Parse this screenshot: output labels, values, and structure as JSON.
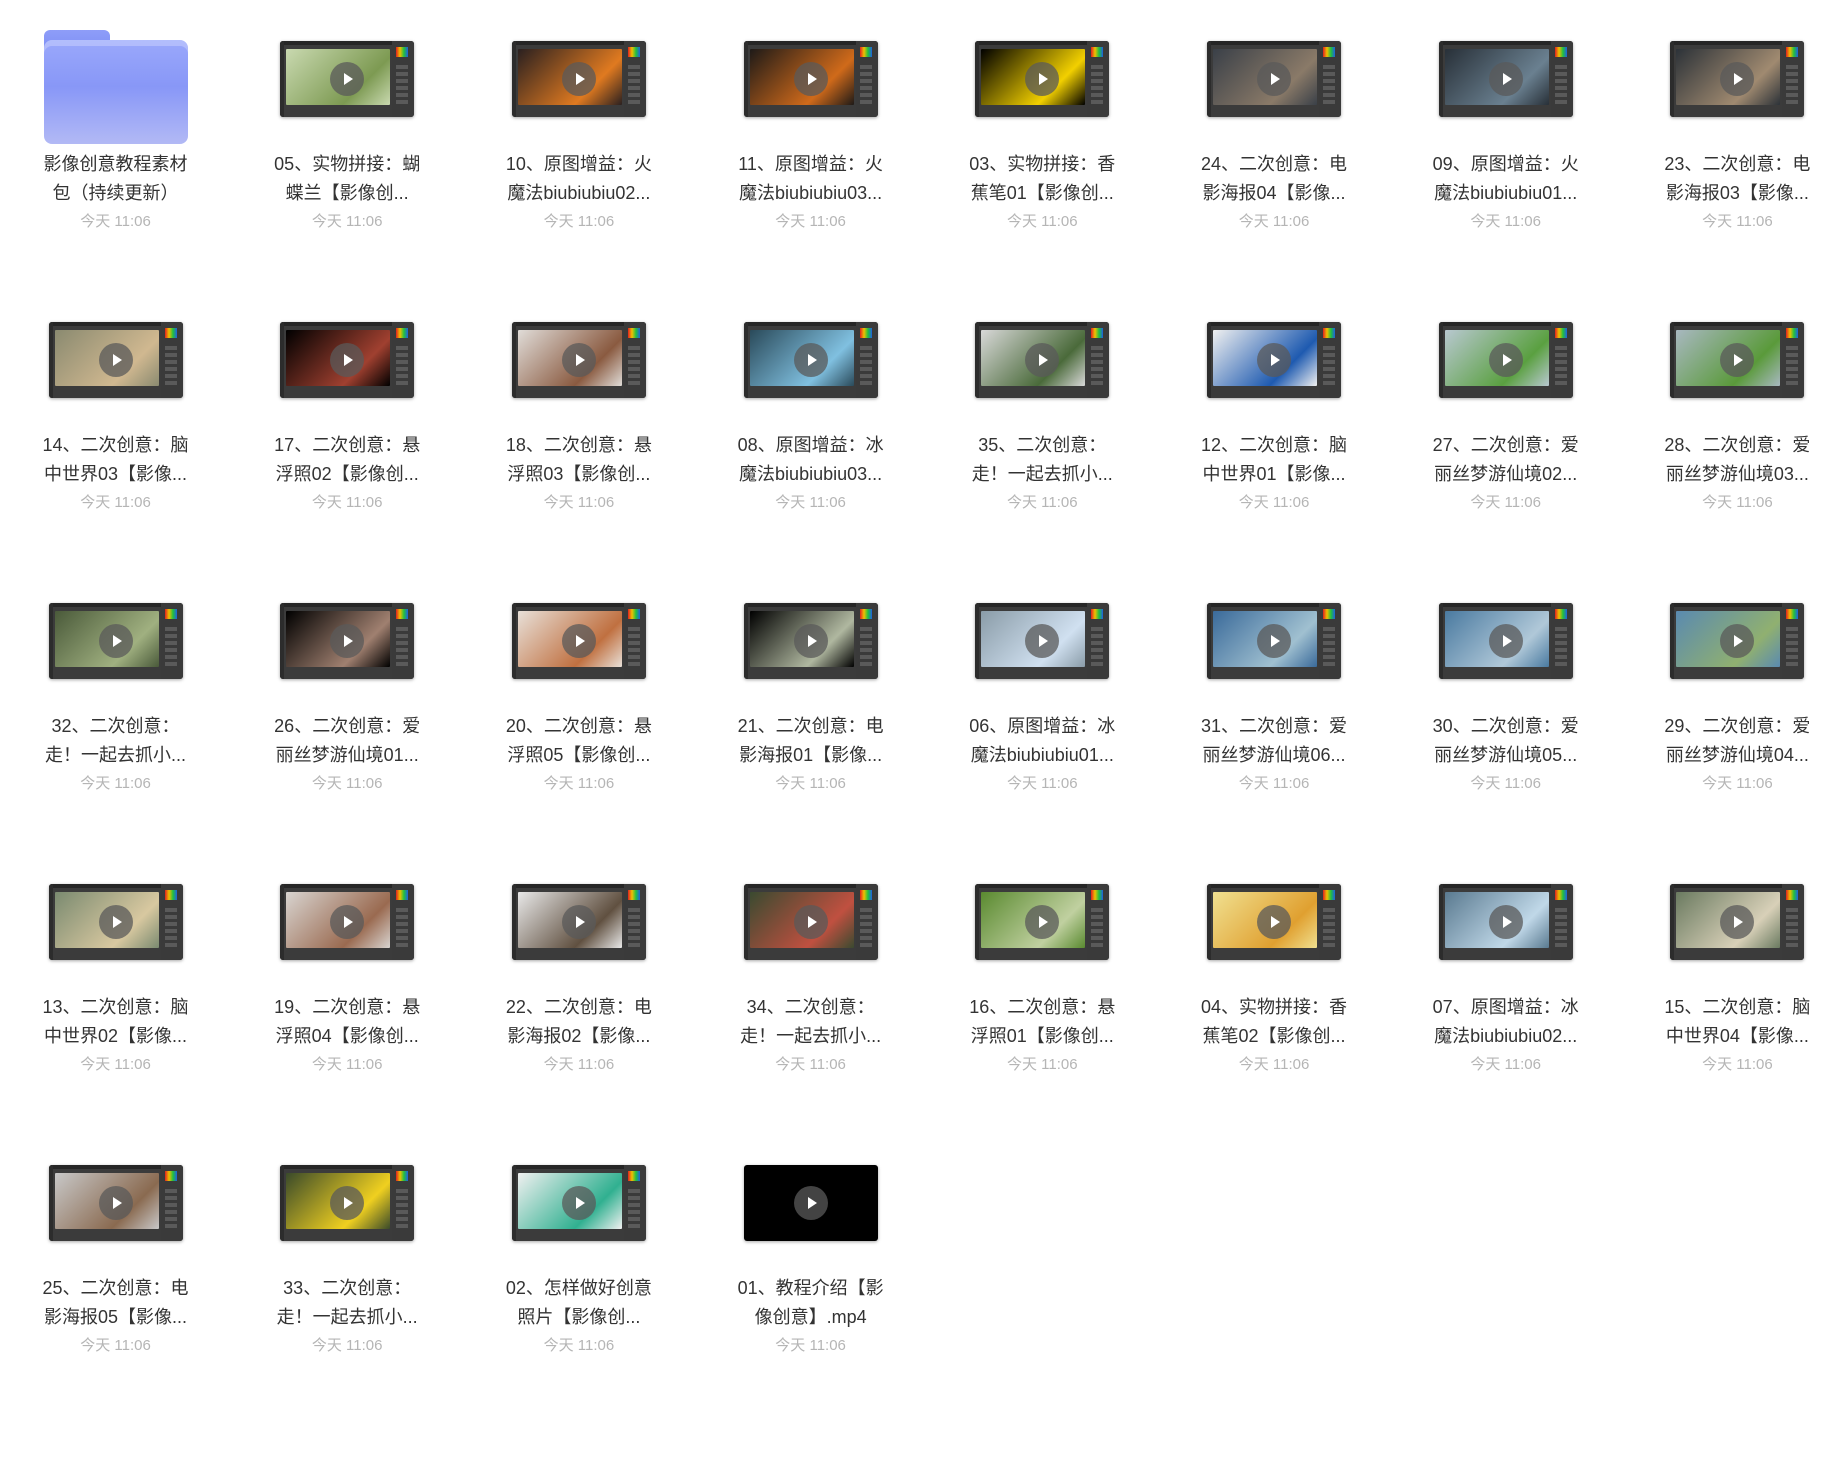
{
  "view": "file-grid",
  "folder": {
    "name": "影像创意教程素材\n包（持续更新）",
    "time": "今天 11:06",
    "icon": "folder-icon",
    "color": "#8e9df8"
  },
  "items": [
    {
      "name": "05、实物拼接：蝴\n蝶兰【影像创...",
      "time": "今天 11:06",
      "thumb": [
        "#c9d9b0",
        "#7d9a52"
      ]
    },
    {
      "name": "10、原图增益：火\n魔法biubiubiu02...",
      "time": "今天 11:06",
      "thumb": [
        "#2a2020",
        "#e07a20"
      ]
    },
    {
      "name": "11、原图增益：火\n魔法biubiubiu03...",
      "time": "今天 11:06",
      "thumb": [
        "#1e1a18",
        "#d06a1a"
      ]
    },
    {
      "name": "03、实物拼接：香\n蕉笔01【影像创...",
      "time": "今天 11:06",
      "thumb": [
        "#000000",
        "#f2d000"
      ]
    },
    {
      "name": "24、二次创意：电\n影海报04【影像...",
      "time": "今天 11:06",
      "thumb": [
        "#3a4048",
        "#8a7a68"
      ]
    },
    {
      "name": "09、原图增益：火\n魔法biubiubiu01...",
      "time": "今天 11:06",
      "thumb": [
        "#283038",
        "#6a8090"
      ]
    },
    {
      "name": "23、二次创意：电\n影海报03【影像...",
      "time": "今天 11:06",
      "thumb": [
        "#2c3238",
        "#a08a70"
      ]
    },
    {
      "name": "14、二次创意：脑\n中世界03【影像...",
      "time": "今天 11:06",
      "thumb": [
        "#8a8a70",
        "#d0b890"
      ]
    },
    {
      "name": "17、二次创意：悬\n浮照02【影像创...",
      "time": "今天 11:06",
      "thumb": [
        "#000000",
        "#a04030"
      ]
    },
    {
      "name": "18、二次创意：悬\n浮照03【影像创...",
      "time": "今天 11:06",
      "thumb": [
        "#e0dcd8",
        "#8a5a40"
      ]
    },
    {
      "name": "08、原图增益：冰\n魔法biubiubiu03...",
      "time": "今天 11:06",
      "thumb": [
        "#2a4a5a",
        "#80c0e0"
      ]
    },
    {
      "name": "35、二次创意：\n走！一起去抓小...",
      "time": "今天 11:06",
      "thumb": [
        "#d8d8d8",
        "#4a6a3a"
      ]
    },
    {
      "name": "12、二次创意：脑\n中世界01【影像...",
      "time": "今天 11:06",
      "thumb": [
        "#f0f0f0",
        "#1e5ab0"
      ]
    },
    {
      "name": "27、二次创意：爱\n丽丝梦游仙境02...",
      "time": "今天 11:06",
      "thumb": [
        "#b8c8d0",
        "#5aa040"
      ]
    },
    {
      "name": "28、二次创意：爱\n丽丝梦游仙境03...",
      "time": "今天 11:06",
      "thumb": [
        "#a8b8c0",
        "#5a9a3a"
      ]
    },
    {
      "name": "32、二次创意：\n走！一起去抓小...",
      "time": "今天 11:06",
      "thumb": [
        "#4a5a3a",
        "#a0b080"
      ]
    },
    {
      "name": "26、二次创意：爱\n丽丝梦游仙境01...",
      "time": "今天 11:06",
      "thumb": [
        "#000000",
        "#a08070"
      ]
    },
    {
      "name": "20、二次创意：悬\n浮照05【影像创...",
      "time": "今天 11:06",
      "thumb": [
        "#e8e0d8",
        "#c07040"
      ]
    },
    {
      "name": "21、二次创意：电\n影海报01【影像...",
      "time": "今天 11:06",
      "thumb": [
        "#000000",
        "#b0b8a0"
      ]
    },
    {
      "name": "06、原图增益：冰\n魔法biubiubiu01...",
      "time": "今天 11:06",
      "thumb": [
        "#8a9ca8",
        "#d0e0f0"
      ]
    },
    {
      "name": "31、二次创意：爱\n丽丝梦游仙境06...",
      "time": "今天 11:06",
      "thumb": [
        "#3a6a9a",
        "#a0c0d0"
      ]
    },
    {
      "name": "30、二次创意：爱\n丽丝梦游仙境05...",
      "time": "今天 11:06",
      "thumb": [
        "#4a7aa0",
        "#b0c8d8"
      ]
    },
    {
      "name": "29、二次创意：爱\n丽丝梦游仙境04...",
      "time": "今天 11:06",
      "thumb": [
        "#5a8ab0",
        "#90b070"
      ]
    },
    {
      "name": "13、二次创意：脑\n中世界02【影像...",
      "time": "今天 11:06",
      "thumb": [
        "#7a8a70",
        "#d8c8a0"
      ]
    },
    {
      "name": "19、二次创意：悬\n浮照04【影像创...",
      "time": "今天 11:06",
      "thumb": [
        "#d8d4d0",
        "#9a6a50"
      ]
    },
    {
      "name": "22、二次创意：电\n影海报02【影像...",
      "time": "今天 11:06",
      "thumb": [
        "#e8e8e8",
        "#605040"
      ]
    },
    {
      "name": "34、二次创意：\n走！一起去抓小...",
      "time": "今天 11:06",
      "thumb": [
        "#3a4a30",
        "#c05040"
      ]
    },
    {
      "name": "16、二次创意：悬\n浮照01【影像创...",
      "time": "今天 11:06",
      "thumb": [
        "#5a8a30",
        "#c0d0a0"
      ]
    },
    {
      "name": "04、实物拼接：香\n蕉笔02【影像创...",
      "time": "今天 11:06",
      "thumb": [
        "#f0e090",
        "#e0a030"
      ]
    },
    {
      "name": "07、原图增益：冰\n魔法biubiubiu02...",
      "time": "今天 11:06",
      "thumb": [
        "#5a7a90",
        "#c0d8e8"
      ]
    },
    {
      "name": "15、二次创意：脑\n中世界04【影像...",
      "time": "今天 11:06",
      "thumb": [
        "#6a7a60",
        "#d8d0b8"
      ]
    },
    {
      "name": "25、二次创意：电\n影海报05【影像...",
      "time": "今天 11:06",
      "thumb": [
        "#c8c8c8",
        "#8a6a50"
      ]
    },
    {
      "name": "33、二次创意：\n走！一起去抓小...",
      "time": "今天 11:06",
      "thumb": [
        "#3a4a2a",
        "#f0d020"
      ]
    },
    {
      "name": "02、怎样做好创意\n照片【影像创...",
      "time": "今天 11:06",
      "thumb": [
        "#f0f0f0",
        "#30b090"
      ]
    },
    {
      "name": "01、教程介绍【影\n像创意】.mp4",
      "time": "今天 11:06",
      "thumb": [
        "#000000",
        "#000000"
      ]
    }
  ]
}
